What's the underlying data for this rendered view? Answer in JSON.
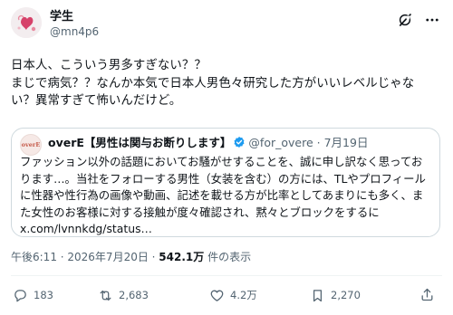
{
  "author": {
    "display_name": "学生",
    "handle": "@mn4p6"
  },
  "tweet": {
    "lines": [
      "日本人、こういう男多すぎない？？",
      "まじで病気？？なんか本気で日本人男色々研究した方がいいレベルじゃな",
      "い？異常すぎて怖いんだけど。"
    ]
  },
  "quote": {
    "avatar_text": "overE",
    "name": "overE【男性は関与お断りします】",
    "handle": "@for_overe",
    "separator": "·",
    "date": "7月19日",
    "lines": [
      "ファッション以外の話題においてお騒がせすることを、誠に申し訳なく思ってお",
      "ります…。当社をフォローする男性（女装を含む）の方には、TLやプロフィール",
      "に性器や性行為の画像や動画、記述を載せる方が比率としてあまりにも多く、ま",
      "た女性のお客様に対する接触が度々確認され、黙々とブロックをするに",
      "x.com/lvnnkdg/status…"
    ]
  },
  "meta": {
    "timestamp": "午後6:11 · 2026年7月20日 · ",
    "views_count": "542.1万",
    "views_label": " 件の表示"
  },
  "actions": {
    "replies": "183",
    "reposts": "2,683",
    "likes": "4.2万",
    "bookmarks": "2,270"
  },
  "colors": {
    "text_primary": "#0f1419",
    "text_secondary": "#536471",
    "verified": "#1d9bf0",
    "border": "#cfd9de",
    "avatar_accent": "#c9395a"
  },
  "icons": {
    "grok": "grok-icon",
    "more": "more-icon",
    "verified": "verified-badge-icon",
    "reply": "reply-icon",
    "repost": "repost-icon",
    "like": "heart-icon",
    "views": "analytics-icon",
    "bookmark": "bookmark-icon",
    "share": "share-icon"
  }
}
